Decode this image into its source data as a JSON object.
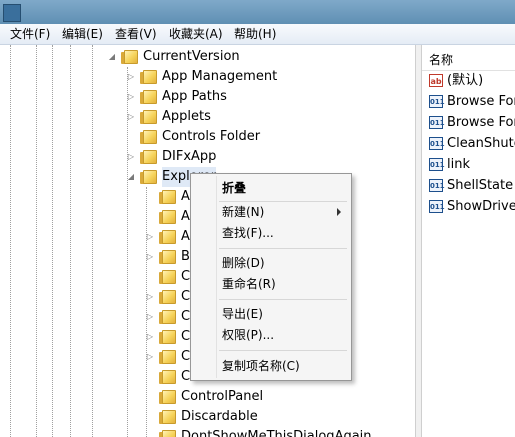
{
  "menubar": [
    {
      "label": "文件(F)"
    },
    {
      "label": "编辑(E)"
    },
    {
      "label": "查看(V)"
    },
    {
      "label": "收藏夹(A)"
    },
    {
      "label": "帮助(H)"
    }
  ],
  "tree": {
    "parent": "CurrentVersion",
    "children": [
      {
        "label": "App Management"
      },
      {
        "label": "App Paths"
      },
      {
        "label": "Applets"
      },
      {
        "label": "Controls Folder"
      },
      {
        "label": "DIFxApp"
      },
      {
        "label": "Explorer"
      }
    ],
    "explorer_children": [
      {
        "label": "A"
      },
      {
        "label": "A"
      },
      {
        "label": "A"
      },
      {
        "label": "B"
      },
      {
        "label": "C"
      },
      {
        "label": "C"
      },
      {
        "label": "C"
      },
      {
        "label": "C"
      },
      {
        "label": "C"
      },
      {
        "label": "C"
      },
      {
        "label": "ControlPanel"
      },
      {
        "label": "Discardable"
      },
      {
        "label": "DontShowMeThisDialogAgain"
      }
    ]
  },
  "values_pane": {
    "header": "名称",
    "items": [
      {
        "label": "(默认)",
        "icon": "string-value-icon"
      },
      {
        "label": "Browse For",
        "icon": "binary-value-icon"
      },
      {
        "label": "Browse For",
        "icon": "binary-value-icon"
      },
      {
        "label": "CleanShutdo",
        "icon": "binary-value-icon"
      },
      {
        "label": "link",
        "icon": "binary-value-icon"
      },
      {
        "label": "ShellState",
        "icon": "binary-value-icon"
      },
      {
        "label": "ShowDriveL",
        "icon": "binary-value-icon"
      }
    ]
  },
  "context_menu": {
    "collapse": "折叠",
    "new": "新建(N)",
    "find": "查找(F)...",
    "delete": "删除(D)",
    "rename": "重命名(R)",
    "export": "导出(E)",
    "permissions": "权限(P)...",
    "copy_key_name": "复制项名称(C)"
  },
  "icon_glyphs": {
    "string": "ab",
    "binary": "011"
  },
  "colors": {
    "titlebar": "#6e9cc0",
    "menubar": "#eef2f8",
    "folder": "#f6d35a",
    "menu_bg": "#f5f5f5"
  }
}
